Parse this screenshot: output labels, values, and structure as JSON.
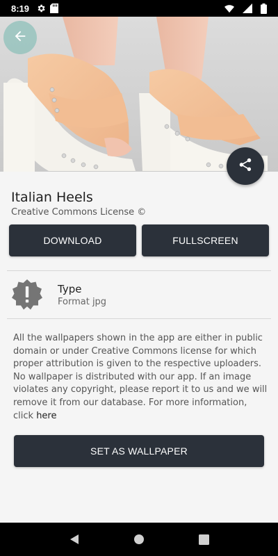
{
  "status_bar": {
    "time": "8:19",
    "icons": [
      "gear-icon",
      "sd-card-icon",
      "wifi-icon",
      "signal-icon",
      "battery-icon"
    ]
  },
  "hero": {
    "subject": "heels-photo",
    "back_icon": "arrow-left-icon",
    "share_icon": "share-icon"
  },
  "wallpaper": {
    "title": "Italian Heels",
    "license": "Creative Commons License ©"
  },
  "actions": {
    "download_label": "DOWNLOAD",
    "fullscreen_label": "FULLSCREEN",
    "set_wallpaper_label": "SET AS WALLPAPER"
  },
  "info": {
    "type_label": "Type",
    "type_value": "Format jpg",
    "icon": "alert-badge-icon"
  },
  "disclaimer": {
    "text": "All the wallpapers shown in the app are either in public domain or under Creative Commons license for which proper attribution is given to the respective uploaders. No wallpaper is distributed with our app. If an image violates any copyright, please report it to us and we will remove it from our database. For more information, click ",
    "link_text": "here"
  },
  "colors": {
    "dark_button": "#2b313a",
    "back_button": "#8dc0ba",
    "background": "#f5f5f5"
  },
  "nav_bar": {
    "icons": [
      "back-triangle-icon",
      "home-circle-icon",
      "recents-square-icon"
    ]
  }
}
